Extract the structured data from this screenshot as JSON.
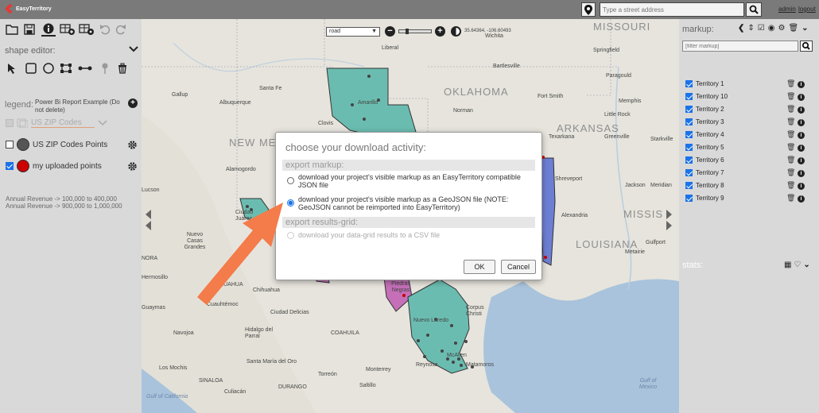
{
  "app": {
    "name": "EasyTerritory"
  },
  "topbar": {
    "address_placeholder": "Type a street address",
    "admin_link": "admin",
    "logout_link": "logout"
  },
  "left_panel": {
    "shape_editor_label": "shape editor:",
    "legend_label": "legend:",
    "legend_name": "Power Bi Report Example (Do not delete)",
    "layer_select": "US ZIP Codes",
    "layers": [
      {
        "label": "US ZIP Codes Points",
        "checked": false,
        "color": "#555555"
      },
      {
        "label": "my uploaded points",
        "checked": true,
        "color": "#cc0000"
      }
    ],
    "revenue_lines": [
      "Annual Revenue -> 100,000 to 400,000",
      "Annual Revenue -> 900,000 to 1,000,000"
    ]
  },
  "map": {
    "basemap_select": "road",
    "coords": "35.64364, -106.60493",
    "state_labels": [
      "MISSOURI",
      "OKLAHOMA",
      "ARKANSAS",
      "NEW MEX",
      "MISSIS",
      "LOUISIANA"
    ],
    "city_labels": [
      "Liberal",
      "Wichita",
      "Springfield",
      "Bartlesville",
      "Santa Fe",
      "Gallup",
      "Albuquerque",
      "Amarillo",
      "Norman",
      "Fort Smith",
      "Paragould",
      "Memphis",
      "Little Rock",
      "Clovis",
      "Texarkana",
      "Greenville",
      "Starkville",
      "Shreveport",
      "Jackson",
      "Meridian",
      "Alamogordo",
      "Ciudad Juárez",
      "Nuevo Casas Grandes",
      "Alexandria",
      "Gulfport",
      "Metairie",
      "CHIHUAHUA",
      "Chihuahua",
      "Hermosillo",
      "Cuauhtémoc",
      "Ciudad Delicias",
      "Guaymas",
      "Navojoa",
      "Hidalgo del Parral",
      "COAHUILA",
      "Nuevo Laredo",
      "Corpus Christi",
      "McAllen",
      "Reynosa",
      "Matamoros",
      "Santa María del Oro",
      "Monterrey",
      "Los Mochis",
      "Torreón",
      "SINALOA",
      "DURANGO",
      "Saltillo",
      "Culiacán",
      "Gulf of California",
      "Gulf of Mexico",
      "Piedras Negras",
      "Lucson",
      "NORA"
    ]
  },
  "right_panel": {
    "markup_label": "markup:",
    "filter_placeholder": "[filter markup]",
    "territories": [
      "Territory 1",
      "Territory 10",
      "Territory 2",
      "Territory 3",
      "Territory 4",
      "Territory 5",
      "Territory 6",
      "Territory 7",
      "Territory 8",
      "Territory 9"
    ],
    "stats_label": "stats:"
  },
  "dialog": {
    "title": "choose your download activity:",
    "section_markup": "export markup:",
    "option_json": "download your project's visible markup as an EasyTerritory compatible JSON file",
    "option_geojson": "download your project's visible markup as a GeoJSON file (NOTE: GeoJSON cannot be reimported into EasyTerritory)",
    "section_results": "export results-grid:",
    "option_csv": "download your data-grid results to a CSV file",
    "selected": "geojson",
    "ok_label": "OK",
    "cancel_label": "Cancel"
  },
  "colors": {
    "accent": "#1a73e8",
    "arrow": "#f47b4a",
    "territory_teal": "#6bbcb0",
    "territory_pink": "#c46fb7",
    "territory_blue": "#6d7fd4"
  }
}
